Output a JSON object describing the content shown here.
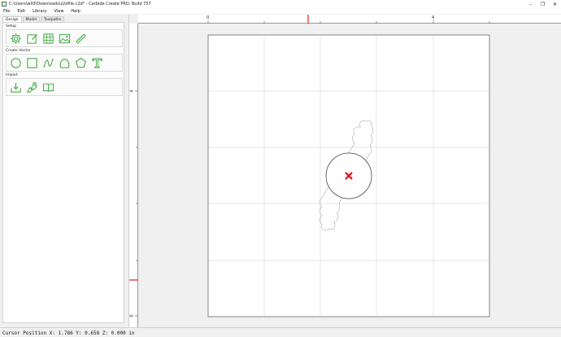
{
  "window": {
    "title": "C:\\Users\\willf\\Downloads\\z2dfile.c2d* - Carbide Create PRO, Build 757",
    "minimize_glyph": "–",
    "maximize_glyph": "❐",
    "close_glyph": "✕"
  },
  "menu": {
    "items": [
      "File",
      "Edit",
      "Library",
      "View",
      "Help"
    ]
  },
  "panel": {
    "tabs": [
      "Design",
      "Model",
      "Toolpaths"
    ],
    "active_tab": "Design",
    "groups": [
      {
        "label": "Setup",
        "tools": [
          "job-setup-gear-icon",
          "edit-vector-icon",
          "grid-icon",
          "image-icon",
          "ruler-icon"
        ]
      },
      {
        "label": "Create Vector",
        "tools": [
          "circle-icon",
          "rectangle-icon",
          "curve-icon",
          "polyline-icon",
          "polygon-icon",
          "text-icon"
        ]
      },
      {
        "label": "Import",
        "tools": [
          "import-icon",
          "import-svg-icon",
          "library-book-icon"
        ]
      }
    ],
    "icon_color": "#3aa63a"
  },
  "rulers": {
    "top_labels": [
      "0",
      "4"
    ],
    "left_labels": [
      "4",
      "0"
    ],
    "marker_color": "#e02020"
  },
  "status": {
    "cursor_position": "Cursor Position X: 1.786 Y: 0.658 Z: 0.000 in"
  }
}
